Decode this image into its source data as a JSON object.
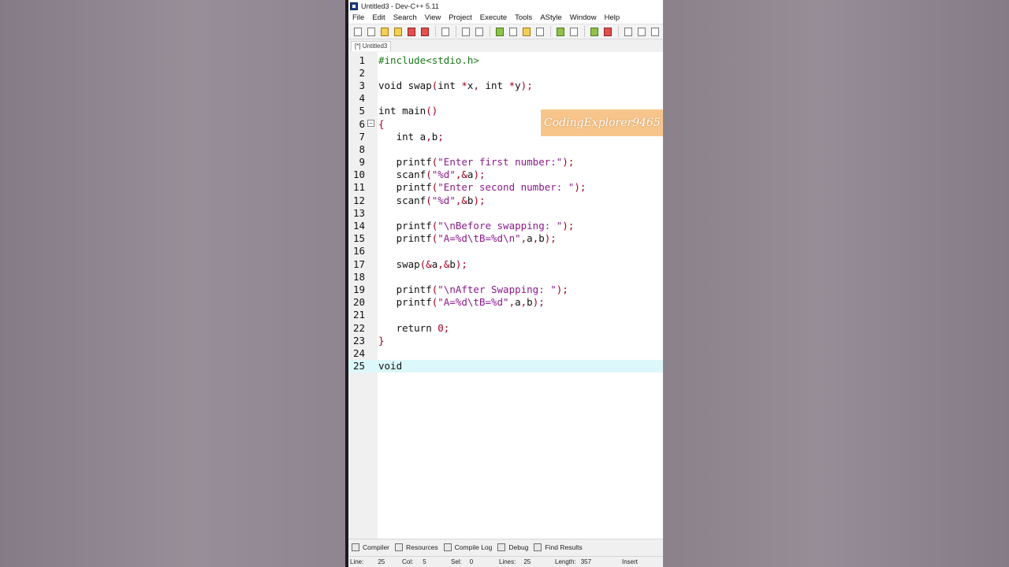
{
  "window": {
    "title": "Untitled3 - Dev-C++ 5.11"
  },
  "menu": [
    "File",
    "Edit",
    "Search",
    "View",
    "Project",
    "Execute",
    "Tools",
    "AStyle",
    "Window",
    "Help"
  ],
  "toolbar_icons": [
    "new-file-icon",
    "open-icon",
    "save-icon",
    "save-all-icon",
    "close-icon",
    "close-all-icon",
    "print-icon",
    "undo-icon",
    "redo-icon",
    "grid-icon",
    "window-icon",
    "class-browser-icon",
    "indent-icon",
    "check-icon",
    "cross-icon",
    "chart-icon",
    "run-icon",
    "zoom-icon",
    "find-icon",
    "panel-icon"
  ],
  "tab": {
    "label": "[*] Untitled3"
  },
  "watermark": "CodingExplorer9465",
  "code": [
    {
      "n": "1",
      "text": "#include<stdio.h>"
    },
    {
      "n": "2",
      "text": ""
    },
    {
      "n": "3",
      "text": "void swap(int *x, int *y);"
    },
    {
      "n": "4",
      "text": ""
    },
    {
      "n": "5",
      "text": "int main()"
    },
    {
      "n": "6",
      "text": "{"
    },
    {
      "n": "7",
      "text": "   int a,b;"
    },
    {
      "n": "8",
      "text": ""
    },
    {
      "n": "9",
      "text": "   printf(\"Enter first number:\");"
    },
    {
      "n": "10",
      "text": "   scanf(\"%d\",&a);"
    },
    {
      "n": "11",
      "text": "   printf(\"Enter second number: \");"
    },
    {
      "n": "12",
      "text": "   scanf(\"%d\",&b);"
    },
    {
      "n": "13",
      "text": ""
    },
    {
      "n": "14",
      "text": "   printf(\"\\nBefore swapping: \");"
    },
    {
      "n": "15",
      "text": "   printf(\"A=%d\\tB=%d\\n\",a,b);"
    },
    {
      "n": "16",
      "text": ""
    },
    {
      "n": "17",
      "text": "   swap(&a,&b);"
    },
    {
      "n": "18",
      "text": ""
    },
    {
      "n": "19",
      "text": "   printf(\"\\nAfter Swapping: \");"
    },
    {
      "n": "20",
      "text": "   printf(\"A=%d\\tB=%d\",a,b);"
    },
    {
      "n": "21",
      "text": ""
    },
    {
      "n": "22",
      "text": "   return 0;"
    },
    {
      "n": "23",
      "text": "}"
    },
    {
      "n": "24",
      "text": ""
    },
    {
      "n": "25",
      "text": "void"
    }
  ],
  "active_line": "25",
  "bottom_tabs": [
    {
      "label": "Compiler",
      "icon": "grid-icon"
    },
    {
      "label": "Resources",
      "icon": "resources-icon"
    },
    {
      "label": "Compile Log",
      "icon": "chart-icon"
    },
    {
      "label": "Debug",
      "icon": "check-icon"
    },
    {
      "label": "Find Results",
      "icon": "find-icon"
    }
  ],
  "status": {
    "line_label": "Line:",
    "line_value": "25",
    "col_label": "Col:",
    "col_value": "5",
    "sel_label": "Sel:",
    "sel_value": "0",
    "lines_label": "Lines:",
    "lines_value": "25",
    "length_label": "Length:",
    "length_value": "357",
    "mode": "Insert"
  }
}
